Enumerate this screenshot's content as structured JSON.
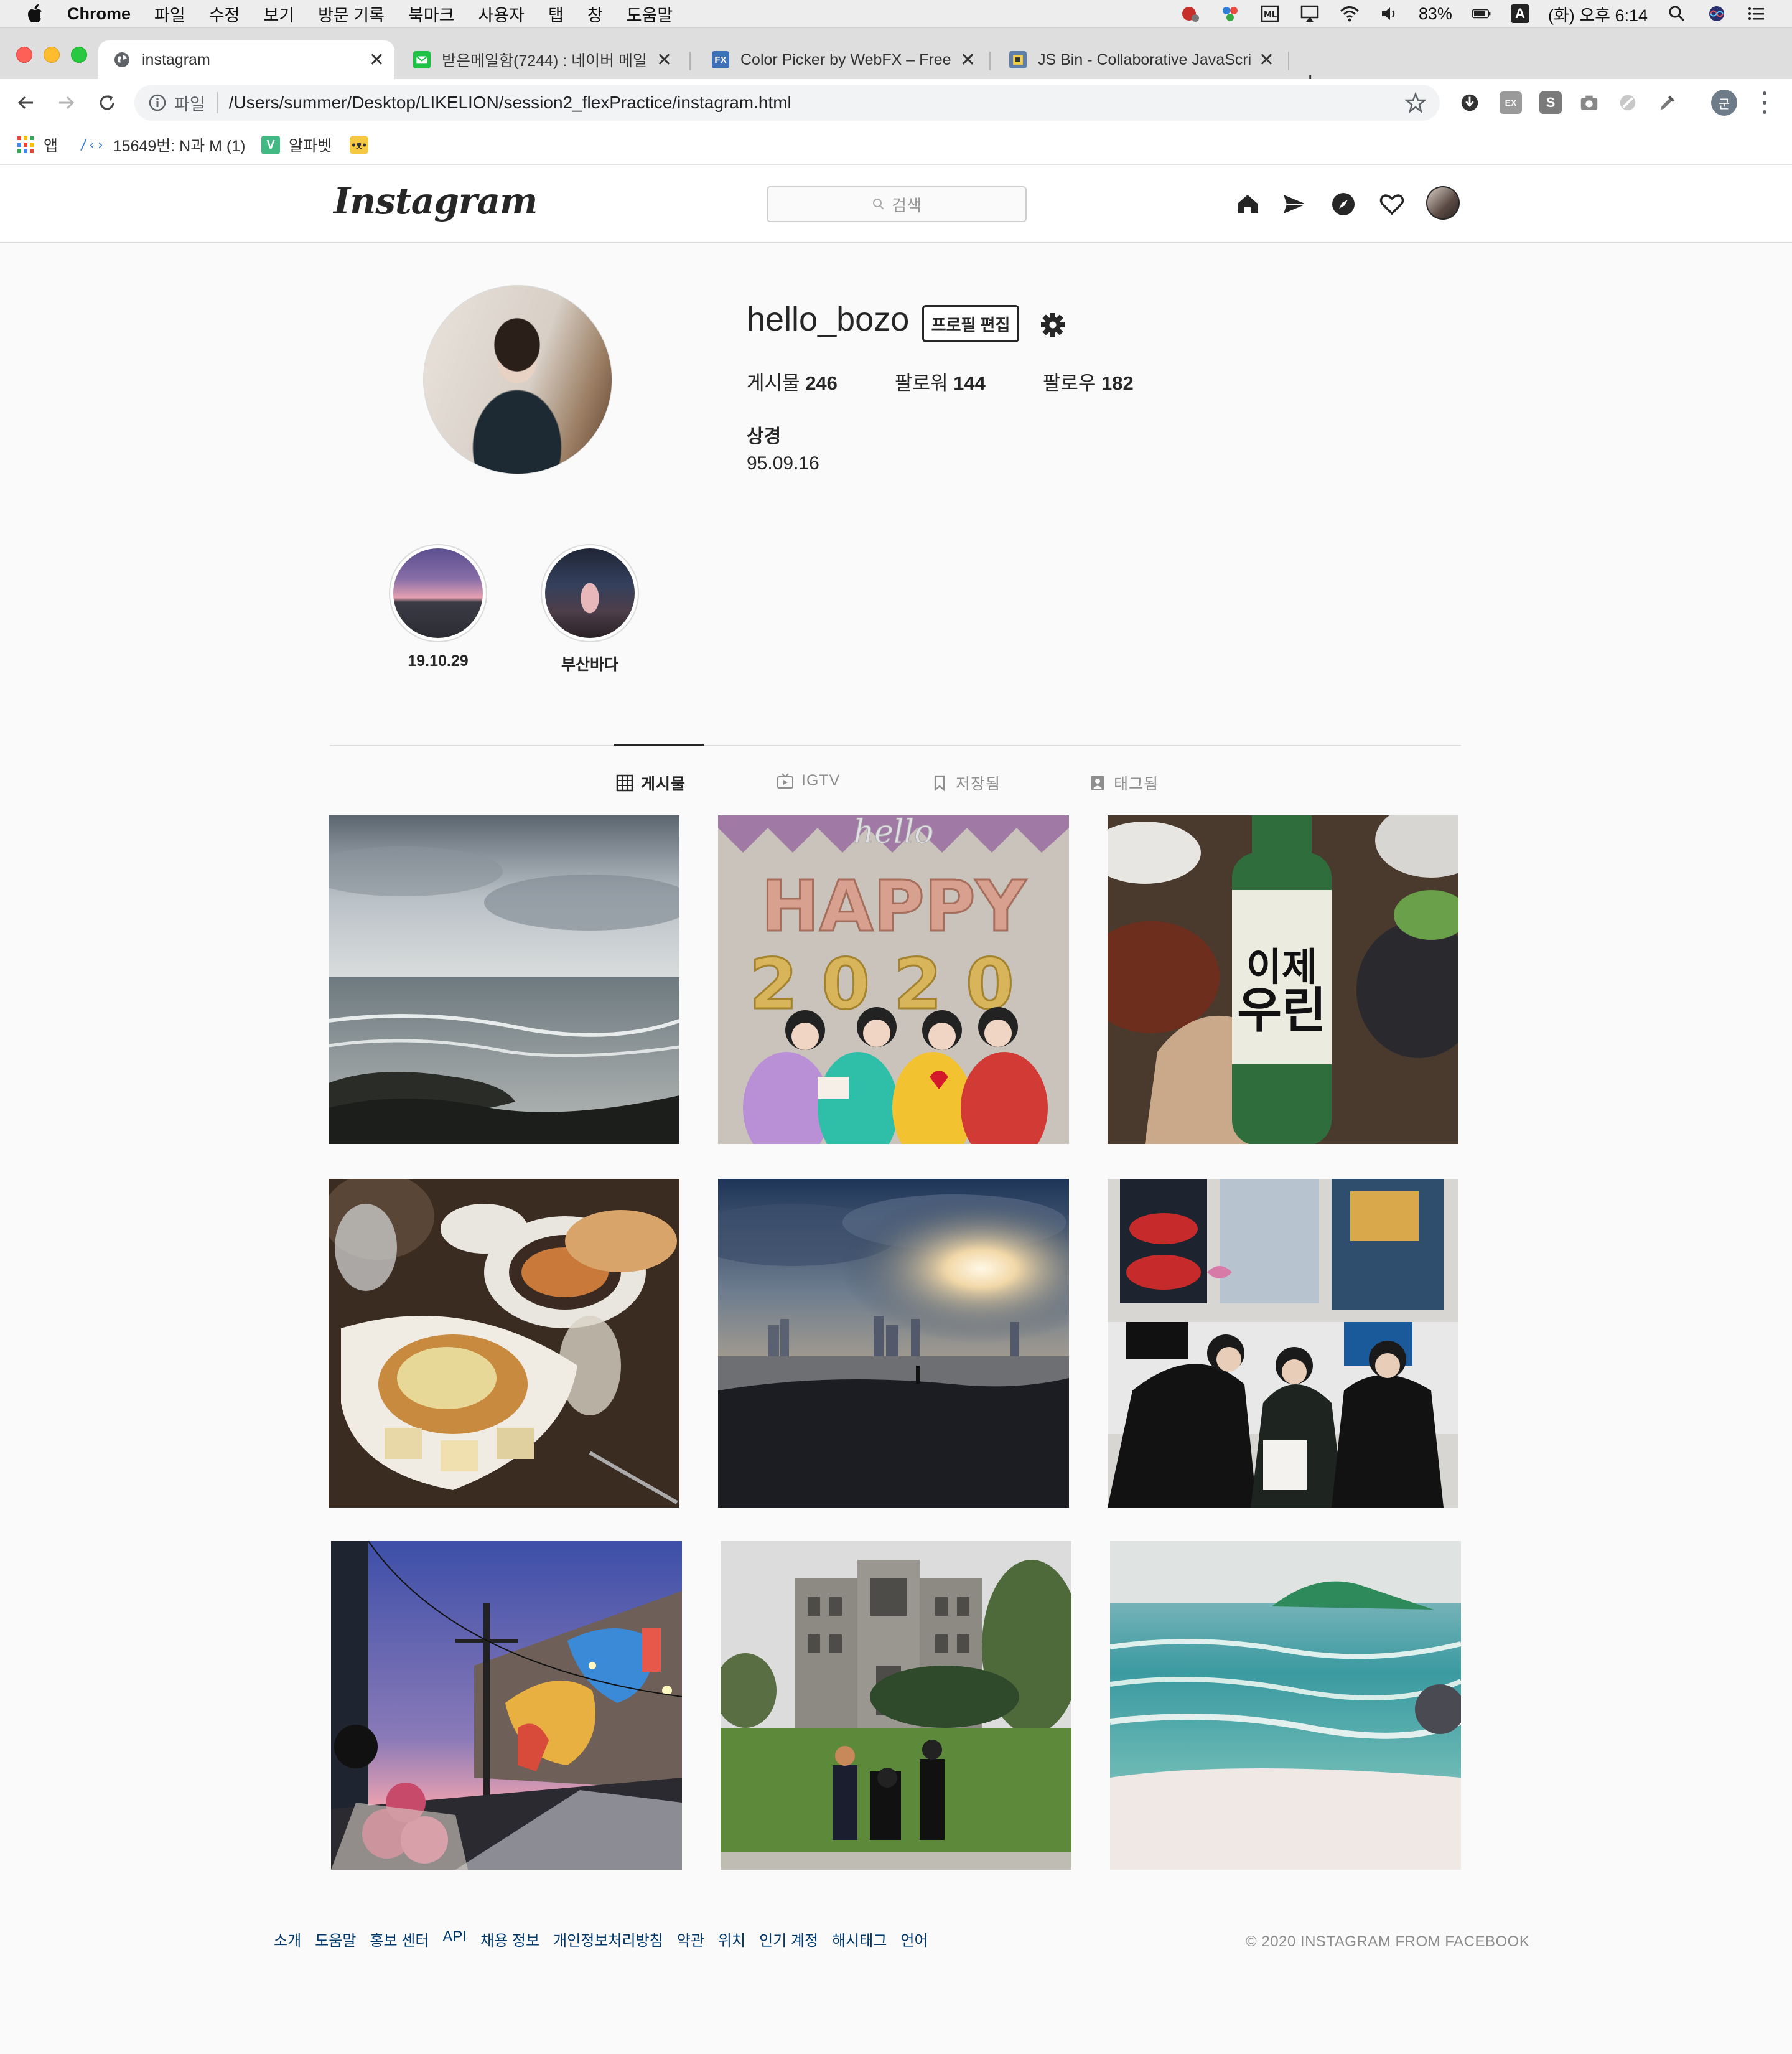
{
  "menubar": {
    "app": "Chrome",
    "menus": [
      "파일",
      "수정",
      "보기",
      "방문 기록",
      "북마크",
      "사용자",
      "탭",
      "창",
      "도움말"
    ],
    "battery": "83%",
    "input_source": "A",
    "clock": "(화) 오후 6:14"
  },
  "tabs": [
    {
      "title": "instagram",
      "icon": "globe-icon",
      "active": true
    },
    {
      "title": "받은메일함(7244) : 네이버 메일",
      "icon": "naver-mail-icon",
      "active": false
    },
    {
      "title": "Color Picker by WebFX – Free I",
      "icon": "webfx-icon",
      "active": false
    },
    {
      "title": "JS Bin - Collaborative JavaScri",
      "icon": "jsbin-icon",
      "active": false
    }
  ],
  "toolbar": {
    "scheme": "파일",
    "url": "/Users/summer/Desktop/LIKELION/session2_flexPractice/instagram.html",
    "profile_initial": "군"
  },
  "bookmarks": [
    {
      "label": "앱",
      "icon": "apps-grid-icon"
    },
    {
      "label": "15649번: N과 M (1)",
      "icon": "code-icon"
    },
    {
      "label": "알파벳",
      "icon": "v-icon"
    },
    {
      "label": "",
      "icon": "cat-face-icon"
    }
  ],
  "instagram": {
    "logo": "Instagram",
    "search_placeholder": "검색",
    "profile": {
      "username": "hello_bozo",
      "edit_label": "프로필 편집",
      "stats": [
        {
          "label": "게시물",
          "value": "246"
        },
        {
          "label": "팔로워",
          "value": "144"
        },
        {
          "label": "팔로우",
          "value": "182"
        }
      ],
      "name": "상경",
      "bio": "95.09.16"
    },
    "highlights": [
      {
        "label": "19.10.29"
      },
      {
        "label": "부산바다"
      }
    ],
    "profile_tabs": [
      {
        "label": "게시물",
        "icon": "grid-icon",
        "active": true
      },
      {
        "label": "IGTV",
        "icon": "igtv-icon",
        "active": false
      },
      {
        "label": "저장됨",
        "icon": "bookmark-icon",
        "active": false
      },
      {
        "label": "태그됨",
        "icon": "tagged-icon",
        "active": false
      }
    ],
    "posts": [
      {
        "subject": "cloudy beach with rocks"
      },
      {
        "subject": "HAPPY 2020 balloons with friends"
      },
      {
        "subject": "soju bottle 이제 우린"
      },
      {
        "subject": "brunch dishes with wine glasses"
      },
      {
        "subject": "sunset over city skyline by sea"
      },
      {
        "subject": "friends posing at exhibition"
      },
      {
        "subject": "street mural at dusk with flowers"
      },
      {
        "subject": "university building with three people"
      },
      {
        "subject": "painting of sea and island"
      }
    ],
    "footer": {
      "links": [
        "소개",
        "도움말",
        "홍보 센터",
        "API",
        "채용 정보",
        "개인정보처리방침",
        "약관",
        "위치",
        "인기 계정",
        "해시태그",
        "언어"
      ],
      "copyright": "© 2020 INSTAGRAM FROM FACEBOOK"
    }
  },
  "colors": {
    "ig_text": "#262626",
    "ig_border": "#dbdbdb",
    "ig_link": "#00376b",
    "page_bg": "#fafafa"
  }
}
